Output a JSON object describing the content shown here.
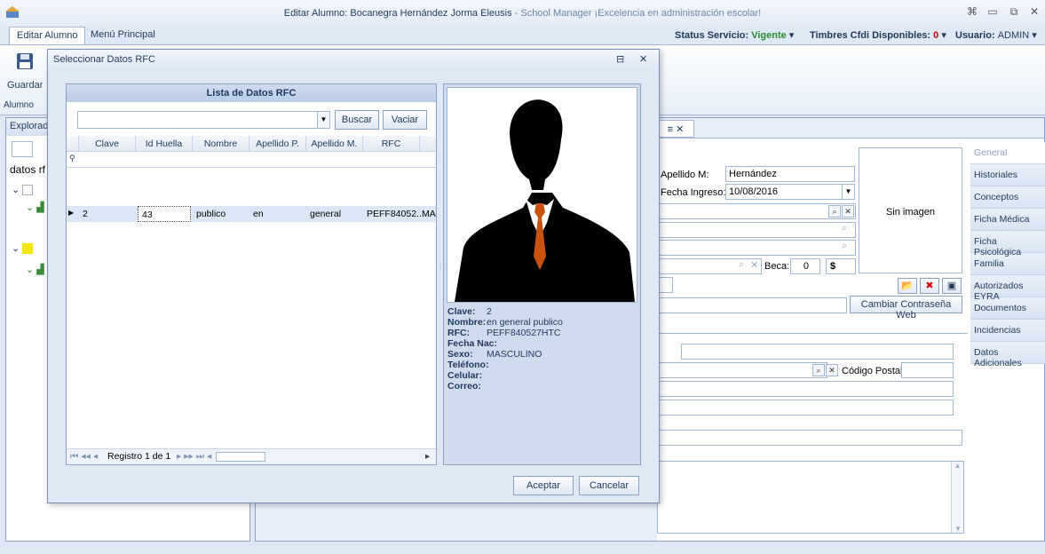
{
  "window": {
    "title": "Editar Alumno: Bocanegra Hernández Jorma Eleusis",
    "subtitle": " - School Manager ¡Excelencia en administración escolar!"
  },
  "ribbon": {
    "tabs": [
      "Editar Alumno",
      "Menú Principal"
    ],
    "save_label": "Guardar",
    "group_label": "Alumno",
    "status_label": "Status Servicio:",
    "status_value": "Vigente",
    "timbres_label": "Timbres Cfdi Disponibles:",
    "timbres_value": "0",
    "user_label": "Usuario:",
    "user_value": "ADMIN"
  },
  "explorer": {
    "header": "Explorad",
    "search_text": "datos rf"
  },
  "form": {
    "apellido_m_label": "Apellido M:",
    "apellido_m_value": "Hernández",
    "fecha_ingreso_label": "Fecha Ingreso:",
    "fecha_ingreso_value": "10/08/2016",
    "beca_label": "Beca:",
    "beca_value": "0",
    "currency_symbol": "$",
    "photo_placeholder": "Sin imagen",
    "change_password_button": "Cambiar Contraseña Web",
    "postal_code_label": "Código Postal:"
  },
  "side_tabs": [
    "General",
    "Historiales",
    "Conceptos",
    "Ficha Médica",
    "Ficha Psicológica",
    "Familia",
    "Autorizados EYRA",
    "Documentos",
    "Incidencias",
    "Datos Adicionales"
  ],
  "dialog": {
    "title": "Seleccionar Datos RFC",
    "grid_caption": "Lista de Datos RFC",
    "search_button": "Buscar",
    "clear_button": "Vaciar",
    "columns": [
      "Clave",
      "Id Huella",
      "Nombre",
      "Apellido P.",
      "Apellido M.",
      "RFC"
    ],
    "row": [
      "2",
      "43",
      "publico",
      "en",
      "general",
      "PEFF84052...",
      "MA"
    ],
    "nav_text": "Registro 1 de 1",
    "accept_button": "Aceptar",
    "cancel_button": "Cancelar",
    "details": [
      {
        "label": "Clave:",
        "value": "2"
      },
      {
        "label": "Nombre:",
        "value": "en general publico"
      },
      {
        "label": "RFC:",
        "value": "PEFF840527HTC"
      },
      {
        "label": "Fecha Nac:",
        "value": ""
      },
      {
        "label": "Sexo:",
        "value": "MASCULINO"
      },
      {
        "label": "Teléfono:",
        "value": ""
      },
      {
        "label": "Celular:",
        "value": ""
      },
      {
        "label": "Correo:",
        "value": ""
      }
    ]
  }
}
